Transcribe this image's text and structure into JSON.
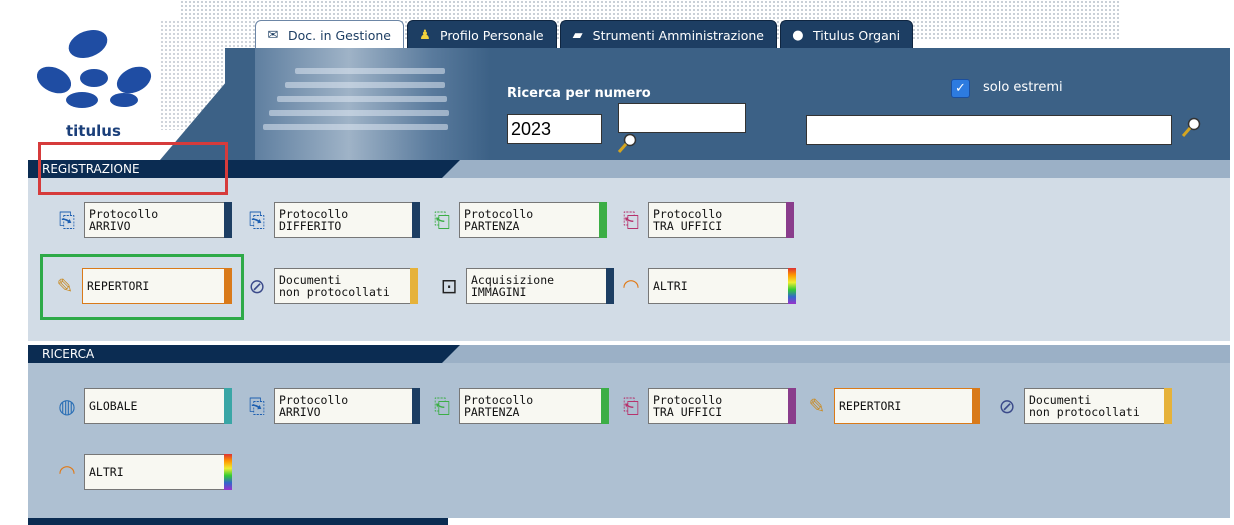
{
  "app": {
    "logo_text": "titulus"
  },
  "tabs": [
    {
      "label": "Doc. in Gestione",
      "icon": "envelope-icon",
      "active": true
    },
    {
      "label": "Profilo Personale",
      "icon": "person-icon",
      "active": false
    },
    {
      "label": "Strumenti Amministrazione",
      "icon": "folder-icon",
      "active": false
    },
    {
      "label": "Titulus Organi",
      "icon": "speech-bubble-icon",
      "active": false
    }
  ],
  "header": {
    "ricerca_label": "Ricerca per numero",
    "year_value": "2023",
    "number_value": "",
    "wide_value": "",
    "solo_estremi_label": "solo estremi",
    "solo_estremi_checked": true
  },
  "registrazione": {
    "title": "REGISTRAZIONE",
    "row1": [
      {
        "label": "Protocollo\nARRIVO",
        "icon": "incoming-doc-icon",
        "accent": "#1d3e63"
      },
      {
        "label": "Protocollo\nDIFFERITO",
        "icon": "incoming-doc-icon",
        "accent": "#1d3e63"
      },
      {
        "label": "Protocollo\nPARTENZA",
        "icon": "outgoing-doc-icon",
        "accent": "#3cae46"
      },
      {
        "label": "Protocollo\nTRA UFFICI",
        "icon": "internal-doc-icon",
        "accent": "#8a3d8c"
      }
    ],
    "row2": [
      {
        "label": "REPERTORI",
        "icon": "pencil-icon",
        "accent": "#d97a1a"
      },
      {
        "label": "Documenti\nnon protocollati",
        "icon": "paperclip-icon",
        "accent": "#e6b23a"
      },
      {
        "label": "Acquisizione\nIMMAGINI",
        "icon": "scanner-icon",
        "accent": "#1d3e63"
      },
      {
        "label": "ALTRI",
        "icon": "rainbow-icon",
        "accent": "rainbow"
      }
    ]
  },
  "ricerca": {
    "title": "RICERCA",
    "row1": [
      {
        "label": "GLOBALE",
        "icon": "globe-icon",
        "accent": "#3aa6a6"
      },
      {
        "label": "Protocollo\nARRIVO",
        "icon": "incoming-doc-icon",
        "accent": "#1d3e63"
      },
      {
        "label": "Protocollo\nPARTENZA",
        "icon": "outgoing-doc-icon",
        "accent": "#3cae46"
      },
      {
        "label": "Protocollo\nTRA UFFICI",
        "icon": "internal-doc-icon",
        "accent": "#8a3d8c"
      },
      {
        "label": "REPERTORI",
        "icon": "pencil-icon",
        "accent": "#d97a1a"
      },
      {
        "label": "Documenti\nnon protocollati",
        "icon": "paperclip-icon",
        "accent": "#e6b23a"
      }
    ],
    "row2": [
      {
        "label": "ALTRI",
        "icon": "rainbow-icon",
        "accent": "rainbow"
      }
    ]
  }
}
